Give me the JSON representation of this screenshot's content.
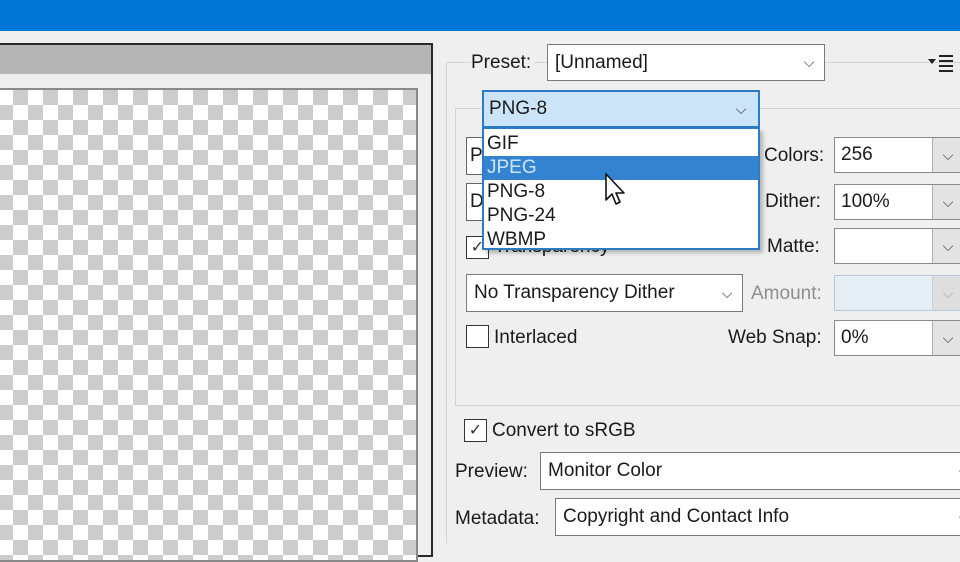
{
  "window": {
    "title_bar_color": "#0078d7"
  },
  "preview_panel": {
    "background": "transparency-checkerboard"
  },
  "settings": {
    "preset": {
      "label": "Preset:",
      "value": "[Unnamed]"
    },
    "panel_menu_icon": "panel-menu-icon",
    "file_format": {
      "value": "PNG-8",
      "expanded": true,
      "options": [
        {
          "label": "GIF",
          "highlighted": false
        },
        {
          "label": "JPEG",
          "highlighted": true
        },
        {
          "label": "PNG-8",
          "highlighted": false
        },
        {
          "label": "PNG-24",
          "highlighted": false
        },
        {
          "label": "WBMP",
          "highlighted": false
        }
      ]
    },
    "hidden_controls": {
      "reduction_partial": "P",
      "dither_algo_partial": "D"
    },
    "colors": {
      "label": "Colors:",
      "value": "256"
    },
    "dither": {
      "label": "Dither:",
      "value": "100%"
    },
    "transparency": {
      "label": "Transparency",
      "checked": true
    },
    "matte": {
      "label": "Matte:",
      "value": ""
    },
    "transparency_dither": {
      "value": "No Transparency Dither"
    },
    "amount": {
      "label": "Amount:",
      "value": "",
      "disabled": true
    },
    "interlaced": {
      "label": "Interlaced",
      "checked": false
    },
    "web_snap": {
      "label": "Web Snap:",
      "value": "0%"
    },
    "convert_srgb": {
      "label": "Convert to sRGB",
      "checked": true
    },
    "preview": {
      "label": "Preview:",
      "value": "Monitor Color"
    },
    "metadata": {
      "label": "Metadata:",
      "value": "Copyright and Contact Info"
    }
  },
  "icons": {
    "chevron": "⌵",
    "check": "✓"
  },
  "colors": {
    "accent": "#0078d7",
    "selection_bg": "#3383d1",
    "combo_focus_bg": "#cce4f7",
    "panel_bg": "#efefef"
  }
}
